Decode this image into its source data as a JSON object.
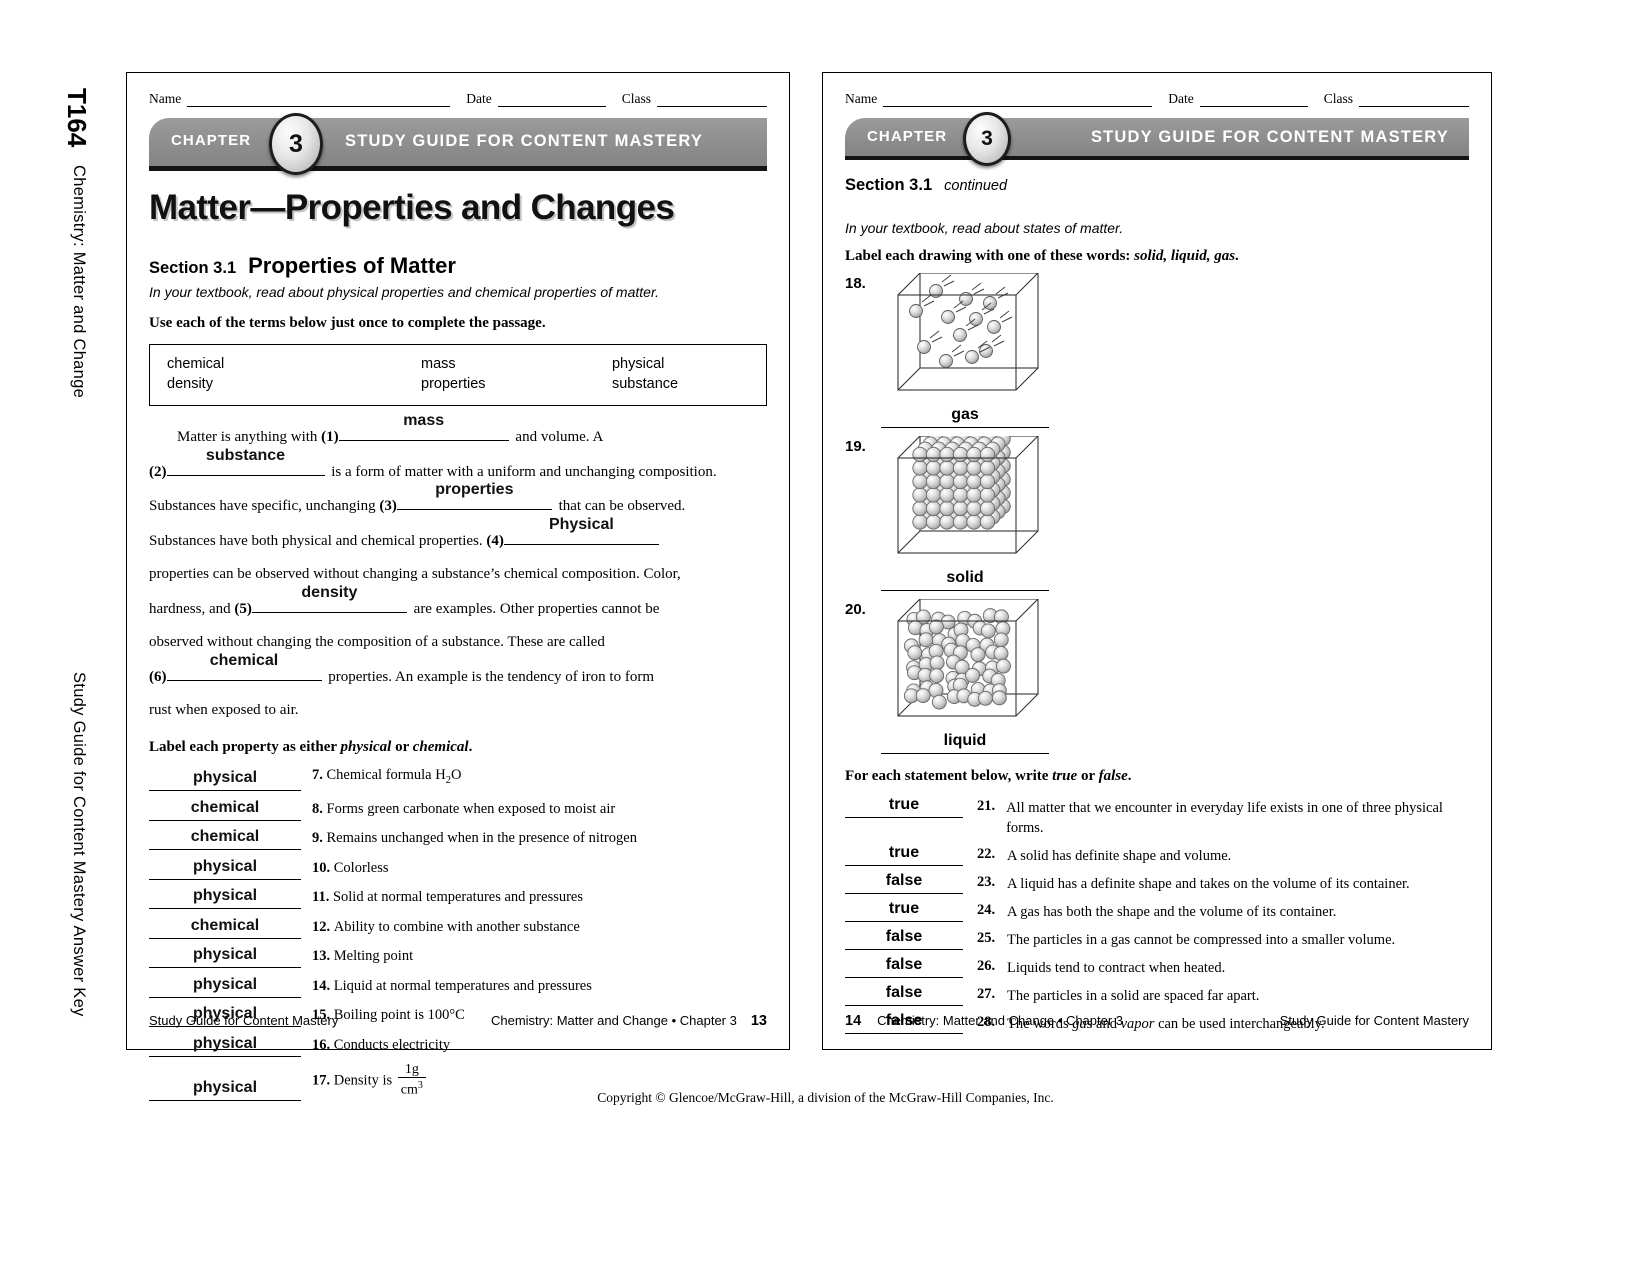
{
  "margin": {
    "folio": "T164",
    "book_title": "Chemistry: Matter and Change",
    "answer_key": "Study Guide for Content Mastery Answer Key"
  },
  "copyright": "Copyright © Glencoe/McGraw-Hill, a division of the McGraw-Hill Companies, Inc.",
  "name_row": {
    "name": "Name",
    "date": "Date",
    "class": "Class"
  },
  "banner": {
    "chapter_word": "CHAPTER",
    "chapter_number": "3",
    "title": "STUDY GUIDE FOR CONTENT MASTERY",
    "bar_color": "#8e8e8e",
    "underline_color": "#141414"
  },
  "left_page": {
    "doc_title": "Matter—Properties and Changes",
    "section_number": "Section 3.1",
    "section_name": "Properties of Matter",
    "read_instruction": "In your textbook, read about physical properties and chemical properties of matter.",
    "terms_instruction": "Use each of the terms below just once to complete the passage.",
    "terms": [
      [
        "chemical",
        "mass",
        "physical"
      ],
      [
        "density",
        "properties",
        "substance"
      ]
    ],
    "passage": {
      "lead": "Matter is anything with",
      "n1": "(1)",
      "a1": "mass",
      "after1": "and volume. A",
      "n2": "(2)",
      "a2": "substance",
      "after2": "is a form of matter with a uniform and unchanging composition.",
      "before3": "Substances have specific, unchanging",
      "n3": "(3)",
      "a3": "properties",
      "after3": "that can be observed.",
      "before4": "Substances have both physical and chemical properties.",
      "n4": "(4)",
      "a4": "Physical",
      "line5": "properties can be observed without changing a substance’s chemical composition. Color,",
      "before5": "hardness, and",
      "n5": "(5)",
      "a5": "density",
      "after5": "are examples. Other properties cannot be",
      "line7": "observed without changing the composition of a substance. These are called",
      "n6": "(6)",
      "a6": "chemical",
      "after6": "properties. An example is the tendency of iron to form",
      "line9": "rust when exposed to air."
    },
    "label_instruction_pre": "Label each property as either ",
    "label_instruction_i1": "physical",
    "label_instruction_mid": " or ",
    "label_instruction_i2": "chemical",
    "label_instruction_post": ".",
    "properties": [
      {
        "answer": "physical",
        "num": "7.",
        "text": "Chemical formula H2O",
        "html": "chemformula"
      },
      {
        "answer": "chemical",
        "num": "8.",
        "text": "Forms green carbonate when exposed to moist air"
      },
      {
        "answer": "chemical",
        "num": "9.",
        "text": "Remains unchanged when in the presence of nitrogen"
      },
      {
        "answer": "physical",
        "num": "10.",
        "text": "Colorless"
      },
      {
        "answer": "physical",
        "num": "11.",
        "text": "Solid at normal temperatures and pressures"
      },
      {
        "answer": "chemical",
        "num": "12.",
        "text": "Ability to combine with another substance"
      },
      {
        "answer": "physical",
        "num": "13.",
        "text": "Melting point"
      },
      {
        "answer": "physical",
        "num": "14.",
        "text": "Liquid at normal temperatures and pressures"
      },
      {
        "answer": "physical",
        "num": "15.",
        "text": "Boiling point is 100°C"
      },
      {
        "answer": "physical",
        "num": "16.",
        "text": "Conducts electricity"
      },
      {
        "answer": "physical",
        "num": "17.",
        "text": "Density is",
        "fraction_num": "1g",
        "fraction_den": "cm3"
      }
    ],
    "footer": {
      "left": "Study Guide for Content Mastery",
      "right": "Chemistry: Matter and Change • Chapter 3",
      "page": "13"
    }
  },
  "right_page": {
    "section_number": "Section 3.1",
    "section_continued": "continued",
    "read_instruction": "In your textbook, read about states of matter.",
    "label_instruction_pre": "Label each drawing with one of these words: ",
    "label_words": "solid, liquid, gas",
    "label_instruction_post": ".",
    "drawings": [
      {
        "num": "18.",
        "answer": "gas",
        "kind": "gas"
      },
      {
        "num": "19.",
        "answer": "solid",
        "kind": "solid"
      },
      {
        "num": "20.",
        "answer": "liquid",
        "kind": "liquid"
      }
    ],
    "tf_instruction_pre": "For each statement below, write ",
    "tf_instruction_i1": "true",
    "tf_instruction_mid": " or ",
    "tf_instruction_i2": "false",
    "tf_instruction_post": ".",
    "statements": [
      {
        "answer": "true",
        "num": "21.",
        "text": "All matter that we encounter in everyday life exists in one of three physical forms."
      },
      {
        "answer": "true",
        "num": "22.",
        "text": "A solid has definite shape and volume."
      },
      {
        "answer": "false",
        "num": "23.",
        "text": "A liquid has a definite shape and takes on the volume of its container."
      },
      {
        "answer": "true",
        "num": "24.",
        "text": "A gas has both the shape and the volume of its container."
      },
      {
        "answer": "false",
        "num": "25.",
        "text": "The particles in a gas cannot be compressed into a smaller volume."
      },
      {
        "answer": "false",
        "num": "26.",
        "text": "Liquids tend to contract when heated."
      },
      {
        "answer": "false",
        "num": "27.",
        "text": "The particles in a solid are spaced far apart."
      },
      {
        "answer": "false",
        "num": "28.",
        "text": "The words gas and vapor can be used interchangeably."
      }
    ],
    "footer": {
      "page": "14",
      "left": "Chemistry: Matter and Change • Chapter 3",
      "right": "Study Guide for Content Mastery"
    }
  }
}
